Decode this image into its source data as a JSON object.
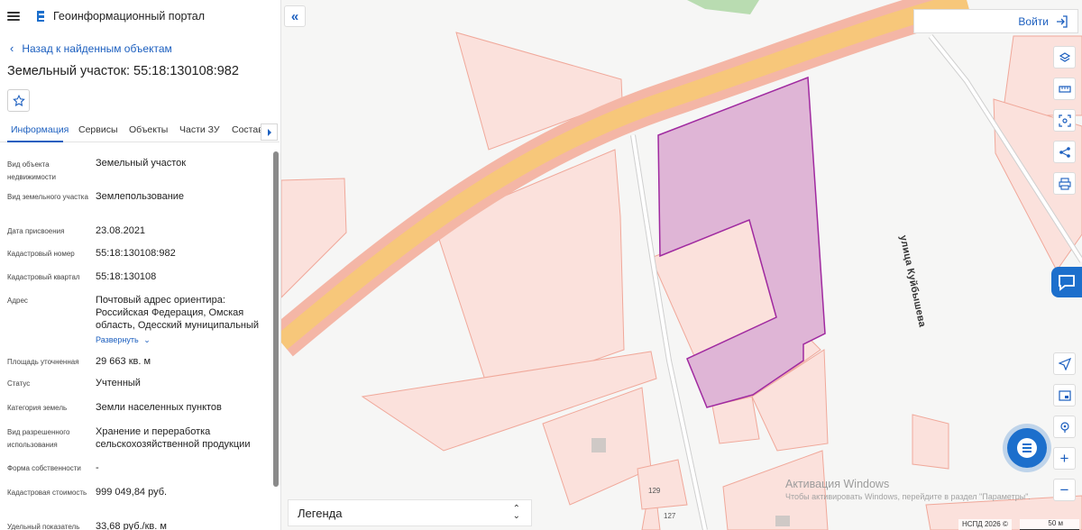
{
  "header": {
    "app_title": "Геоинформационный портал",
    "menu_icon": "hamburger-menu-icon",
    "logo_icon": "portal-logo-icon"
  },
  "navigation": {
    "back_label": "Назад к найденным объектам"
  },
  "object": {
    "title": "Земельный участок: 55:18:130108:982"
  },
  "tabs": [
    {
      "label": "Информация",
      "active": true
    },
    {
      "label": "Сервисы",
      "active": false
    },
    {
      "label": "Объекты",
      "active": false
    },
    {
      "label": "Части ЗУ",
      "active": false
    },
    {
      "label": "Состав",
      "active": false
    }
  ],
  "properties": [
    {
      "label": "Вид объекта недвижимости",
      "value": "Земельный участок"
    },
    {
      "label": "Вид земельного участка",
      "value": "Землепользование"
    },
    {
      "label": "Дата присвоения",
      "value": "23.08.2021"
    },
    {
      "label": "Кадастровый номер",
      "value": "55:18:130108:982"
    },
    {
      "label": "Кадастровый квартал",
      "value": "55:18:130108"
    },
    {
      "label": "Адрес",
      "value": "Почтовый адрес ориентира: Российская Федерация, Омская область, Одесский муниципальный"
    },
    {
      "label": "Площадь уточненная",
      "value": "29 663 кв. м"
    },
    {
      "label": "Статус",
      "value": "Учтенный"
    },
    {
      "label": "Категория земель",
      "value": "Земли населенных пунктов"
    },
    {
      "label": "Вид разрешенного использования",
      "value": "Хранение и переработка сельскохозяйственной продукции"
    },
    {
      "label": "Форма собственности",
      "value": "-"
    },
    {
      "label": "Кадастровая стоимость",
      "value": "999 049,84 руб."
    },
    {
      "label": "Удельный показатель",
      "value": "33,68 руб./кв. м"
    }
  ],
  "expand_label": "Развернуть",
  "map": {
    "login_label": "Войти",
    "legend_label": "Легенда",
    "street_label": "улица Куйбышева",
    "house_numbers": [
      "129",
      "127"
    ],
    "attribution": "НСПД 2026 ©",
    "scale_label": "50 м",
    "watermark_title": "Активация Windows",
    "watermark_subtitle": "Чтобы активировать Windows, перейдите в раздел \"Параметры\".",
    "tool_icons": [
      "layers-icon",
      "ruler-icon",
      "area-select-icon",
      "share-icon",
      "print-icon",
      "geolocation-icon",
      "minimap-icon",
      "search-location-icon",
      "zoom-in-icon",
      "zoom-out-icon"
    ],
    "colors": {
      "parcel_fill": "#dfb5d6",
      "parcel_stroke": "#a02aa0",
      "road_fill": "#f7c77a",
      "cadastre_stroke": "#f0a89a",
      "accent": "#1c6fcc"
    }
  }
}
